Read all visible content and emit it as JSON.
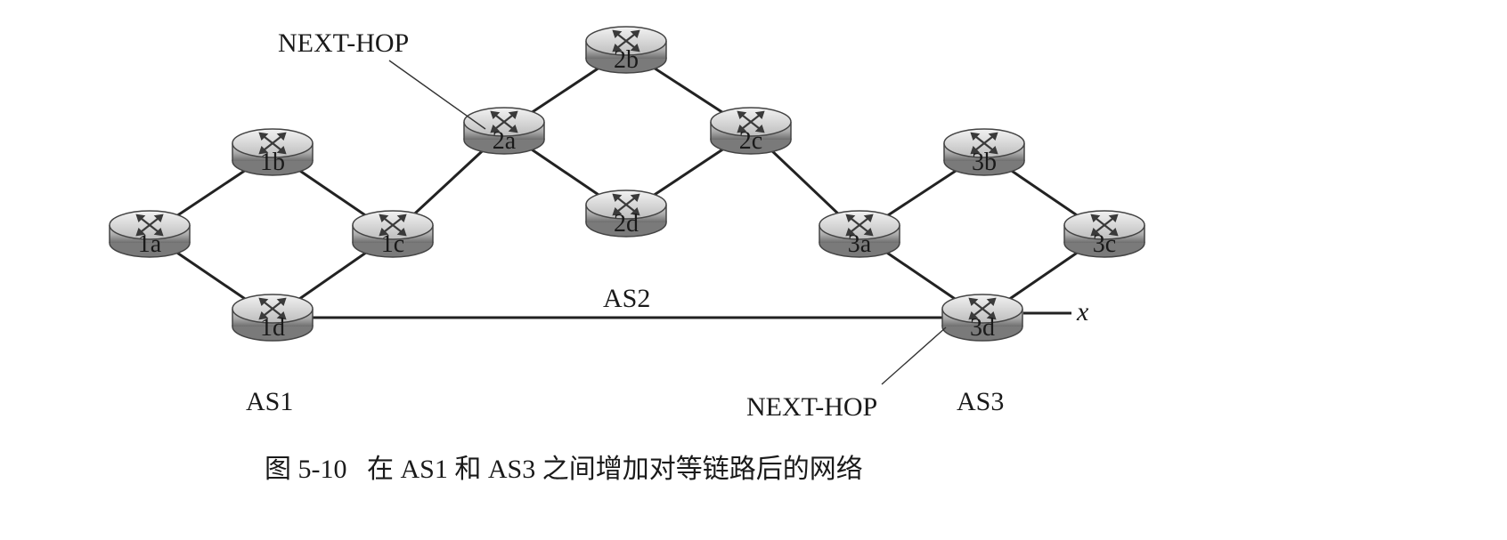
{
  "diagram": {
    "routers": [
      {
        "id": "1a",
        "label": "1a"
      },
      {
        "id": "1b",
        "label": "1b"
      },
      {
        "id": "1c",
        "label": "1c"
      },
      {
        "id": "1d",
        "label": "1d"
      },
      {
        "id": "2a",
        "label": "2a"
      },
      {
        "id": "2b",
        "label": "2b"
      },
      {
        "id": "2c",
        "label": "2c"
      },
      {
        "id": "2d",
        "label": "2d"
      },
      {
        "id": "3a",
        "label": "3a"
      },
      {
        "id": "3b",
        "label": "3b"
      },
      {
        "id": "3c",
        "label": "3c"
      },
      {
        "id": "3d",
        "label": "3d"
      }
    ],
    "links": [
      [
        "1a",
        "1b"
      ],
      [
        "1b",
        "1c"
      ],
      [
        "1a",
        "1d"
      ],
      [
        "1d",
        "1c"
      ],
      [
        "1c",
        "2a"
      ],
      [
        "2a",
        "2b"
      ],
      [
        "2b",
        "2c"
      ],
      [
        "2a",
        "2d"
      ],
      [
        "2d",
        "2c"
      ],
      [
        "2c",
        "3a"
      ],
      [
        "3a",
        "3b"
      ],
      [
        "3b",
        "3c"
      ],
      [
        "3a",
        "3d"
      ],
      [
        "3d",
        "3c"
      ],
      [
        "1d",
        "3d"
      ]
    ],
    "labels": {
      "as1": "AS1",
      "as2": "AS2",
      "as3": "AS3",
      "next_hop_top": "NEXT-HOP",
      "next_hop_bottom": "NEXT-HOP",
      "external_x": "x"
    },
    "caption": "图 5-10   在 AS1 和 AS3 之间增加对等链路后的网络"
  }
}
